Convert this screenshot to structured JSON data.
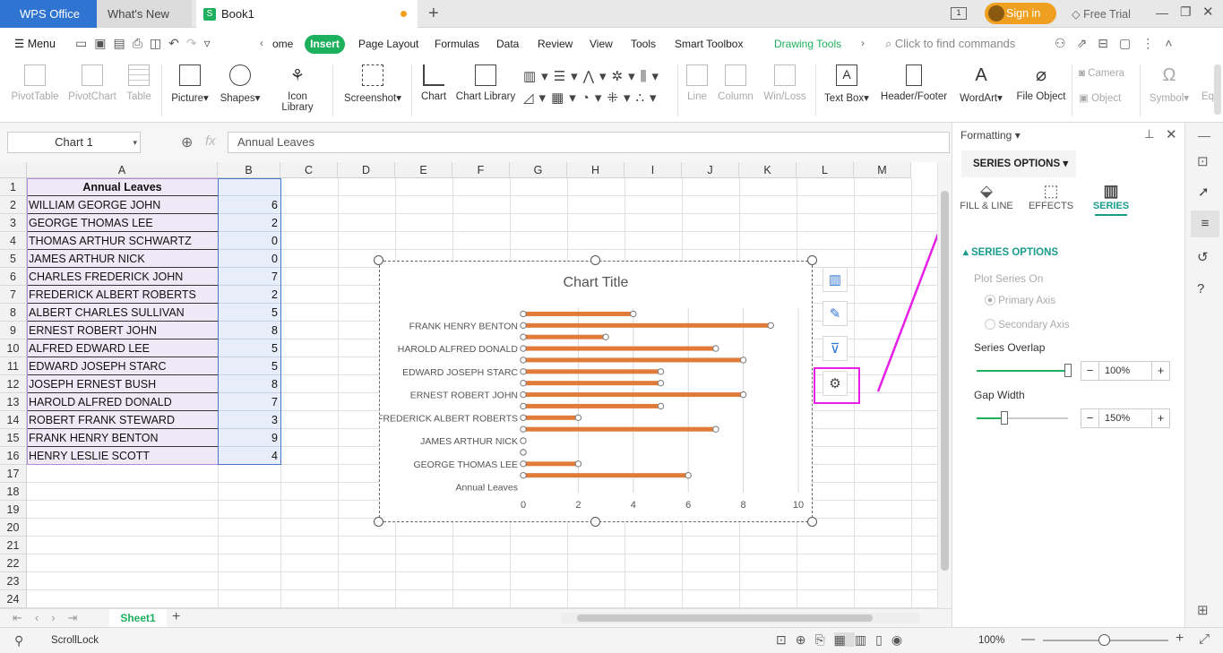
{
  "tabs": {
    "wps": "WPS Office",
    "whats_new": "What's New",
    "book": "Book1",
    "sign_in": "Sign in",
    "free_trial": "Free Trial"
  },
  "menu": {
    "menu_label": "Menu",
    "items": [
      "ome",
      "Insert",
      "Page Layout",
      "Formulas",
      "Data",
      "Review",
      "View",
      "Tools",
      "Smart Toolbox",
      "Drawing Tools"
    ],
    "search_placeholder": "Click to find commands"
  },
  "ribbon": {
    "pivot_table": "PivotTable",
    "pivot_chart": "PivotChart",
    "table": "Table",
    "picture": "Picture",
    "shapes": "Shapes",
    "icon_library": "Icon Library",
    "screenshot": "Screenshot",
    "chart": "Chart",
    "chart_library": "Chart Library",
    "line": "Line",
    "column": "Column",
    "win_loss": "Win/Loss",
    "text_box": "Text Box",
    "header_footer": "Header/Footer",
    "wordart": "WordArt",
    "file_object": "File Object",
    "camera": "Camera",
    "object": "Object",
    "symbol": "Symbol",
    "eq": "Eq"
  },
  "formula_bar": {
    "name_box": "Chart 1",
    "fx": "fx",
    "content": "Annual Leaves"
  },
  "columns": [
    "A",
    "B",
    "C",
    "D",
    "E",
    "F",
    "G",
    "H",
    "I",
    "J",
    "K",
    "L",
    "M"
  ],
  "rows": [
    "1",
    "2",
    "3",
    "4",
    "5",
    "6",
    "7",
    "8",
    "9",
    "10",
    "11",
    "12",
    "13",
    "14",
    "15",
    "16",
    "17",
    "18",
    "19",
    "20",
    "21",
    "22",
    "23",
    "24"
  ],
  "table": {
    "header": "Annual Leaves",
    "names": [
      "WILLIAM GEORGE JOHN",
      "GEORGE THOMAS LEE",
      "THOMAS ARTHUR SCHWARTZ",
      "JAMES ARTHUR NICK",
      "CHARLES FREDERICK JOHN",
      "FREDERICK ALBERT ROBERTS",
      "ALBERT CHARLES SULLIVAN",
      "ERNEST ROBERT JOHN",
      "ALFRED EDWARD LEE",
      "EDWARD JOSEPH STARC",
      "JOSEPH ERNEST BUSH",
      "HAROLD ALFRED DONALD",
      "ROBERT FRANK STEWARD",
      "FRANK HENRY BENTON",
      "HENRY LESLIE SCOTT"
    ],
    "values": [
      "6",
      "2",
      "0",
      "0",
      "7",
      "2",
      "5",
      "8",
      "5",
      "5",
      "8",
      "7",
      "3",
      "9",
      "4"
    ]
  },
  "chart_data": {
    "type": "bar",
    "title": "Chart Title",
    "categories": [
      "Annual Leaves",
      "WILLIAM GEORGE JOHN",
      "GEORGE THOMAS LEE",
      "THOMAS ARTHUR SCHWARTZ",
      "JAMES ARTHUR NICK",
      "CHARLES FREDERICK JOHN",
      "FREDERICK ALBERT ROBERTS",
      "ALBERT CHARLES SULLIVAN",
      "ERNEST ROBERT JOHN",
      "ALFRED EDWARD LEE",
      "EDWARD JOSEPH STARC",
      "JOSEPH ERNEST BUSH",
      "HAROLD ALFRED DONALD",
      "ROBERT FRANK STEWARD",
      "FRANK HENRY BENTON",
      "HENRY LESLIE SCOTT"
    ],
    "shown_labels": [
      "Annual Leaves",
      "",
      "GEORGE THOMAS LEE",
      "",
      "JAMES ARTHUR NICK",
      "",
      "FREDERICK ALBERT ROBERTS",
      "",
      "ERNEST ROBERT JOHN",
      "",
      "EDWARD JOSEPH STARC",
      "",
      "HAROLD ALFRED DONALD",
      "",
      "FRANK HENRY BENTON",
      ""
    ],
    "values": [
      null,
      6,
      2,
      0,
      0,
      7,
      2,
      5,
      8,
      5,
      5,
      8,
      7,
      3,
      9,
      4
    ],
    "xlim": [
      0,
      10
    ],
    "xticks": [
      "0",
      "2",
      "4",
      "6",
      "8",
      "10"
    ],
    "orientation": "horizontal",
    "bar_color": "#e07b39",
    "grid": true
  },
  "sheet": {
    "name": "Sheet1"
  },
  "status": {
    "scroll_lock": "ScrollLock",
    "zoom": "100%"
  },
  "panel": {
    "title": "Formatting",
    "dropdown": "SERIES OPTIONS",
    "tabs": [
      "FILL & LINE",
      "EFFECTS",
      "SERIES"
    ],
    "section": "SERIES OPTIONS",
    "plot_on": "Plot Series On",
    "primary": "Primary Axis",
    "secondary": "Secondary Axis",
    "overlap_label": "Series Overlap",
    "overlap_value": "100%",
    "overlap_level": 1.0,
    "gap_label": "Gap Width",
    "gap_value": "150%",
    "gap_level": 0.3
  },
  "colors": {
    "accent": "#2f74d0",
    "highlight": "#e61ee6",
    "insert_tab": "#1db05d",
    "series": "#1a9c8c"
  }
}
